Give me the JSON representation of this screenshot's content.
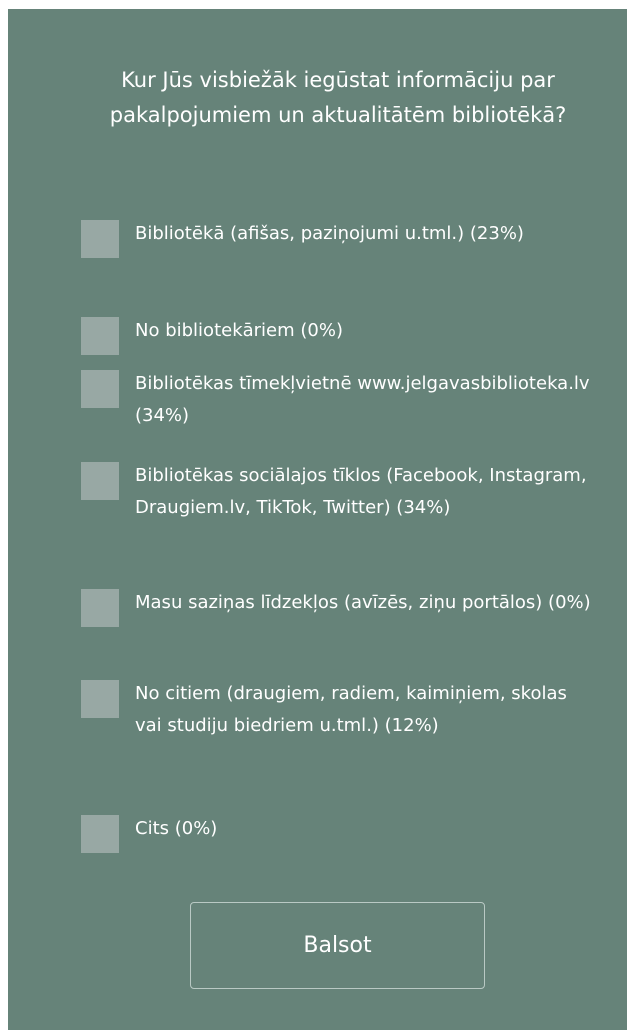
{
  "poll": {
    "question": "Kur Jūs visbiežāk iegūstat informāciju par pakalpojumiem un aktualitātēm bibliotēkā?",
    "options": [
      {
        "label": "Bibliotēkā (afišas, paziņojumi u.tml.) (23%)",
        "percent": 23,
        "checked": false
      },
      {
        "label": "No bibliotekāriem (0%)",
        "percent": 0,
        "checked": false
      },
      {
        "label": "Bibliotēkas tīmekļvietnē www.jelgavasbiblioteka.lv (34%)",
        "percent": 34,
        "checked": false
      },
      {
        "label": "Bibliotēkas sociālajos tīklos (Facebook, Instagram, Draugiem.lv, TikTok, Twitter) (34%)",
        "percent": 34,
        "checked": false
      },
      {
        "label": "Masu saziņas līdzekļos (avīzēs, ziņu portālos) (0%)",
        "percent": 0,
        "checked": false
      },
      {
        "label": "No citiem (draugiem, radiem, kaimiņiem, skolas vai studiju biedriem u.tml.) (12%)",
        "percent": 12,
        "checked": false
      },
      {
        "label": "Cits (0%)",
        "percent": 0,
        "checked": false
      }
    ],
    "vote_button_label": "Balsot"
  },
  "colors": {
    "panel_background": "#668379",
    "checkbox_fill": "#98a8a4",
    "text": "#ffffff",
    "button_border": "#b9c9c4"
  }
}
